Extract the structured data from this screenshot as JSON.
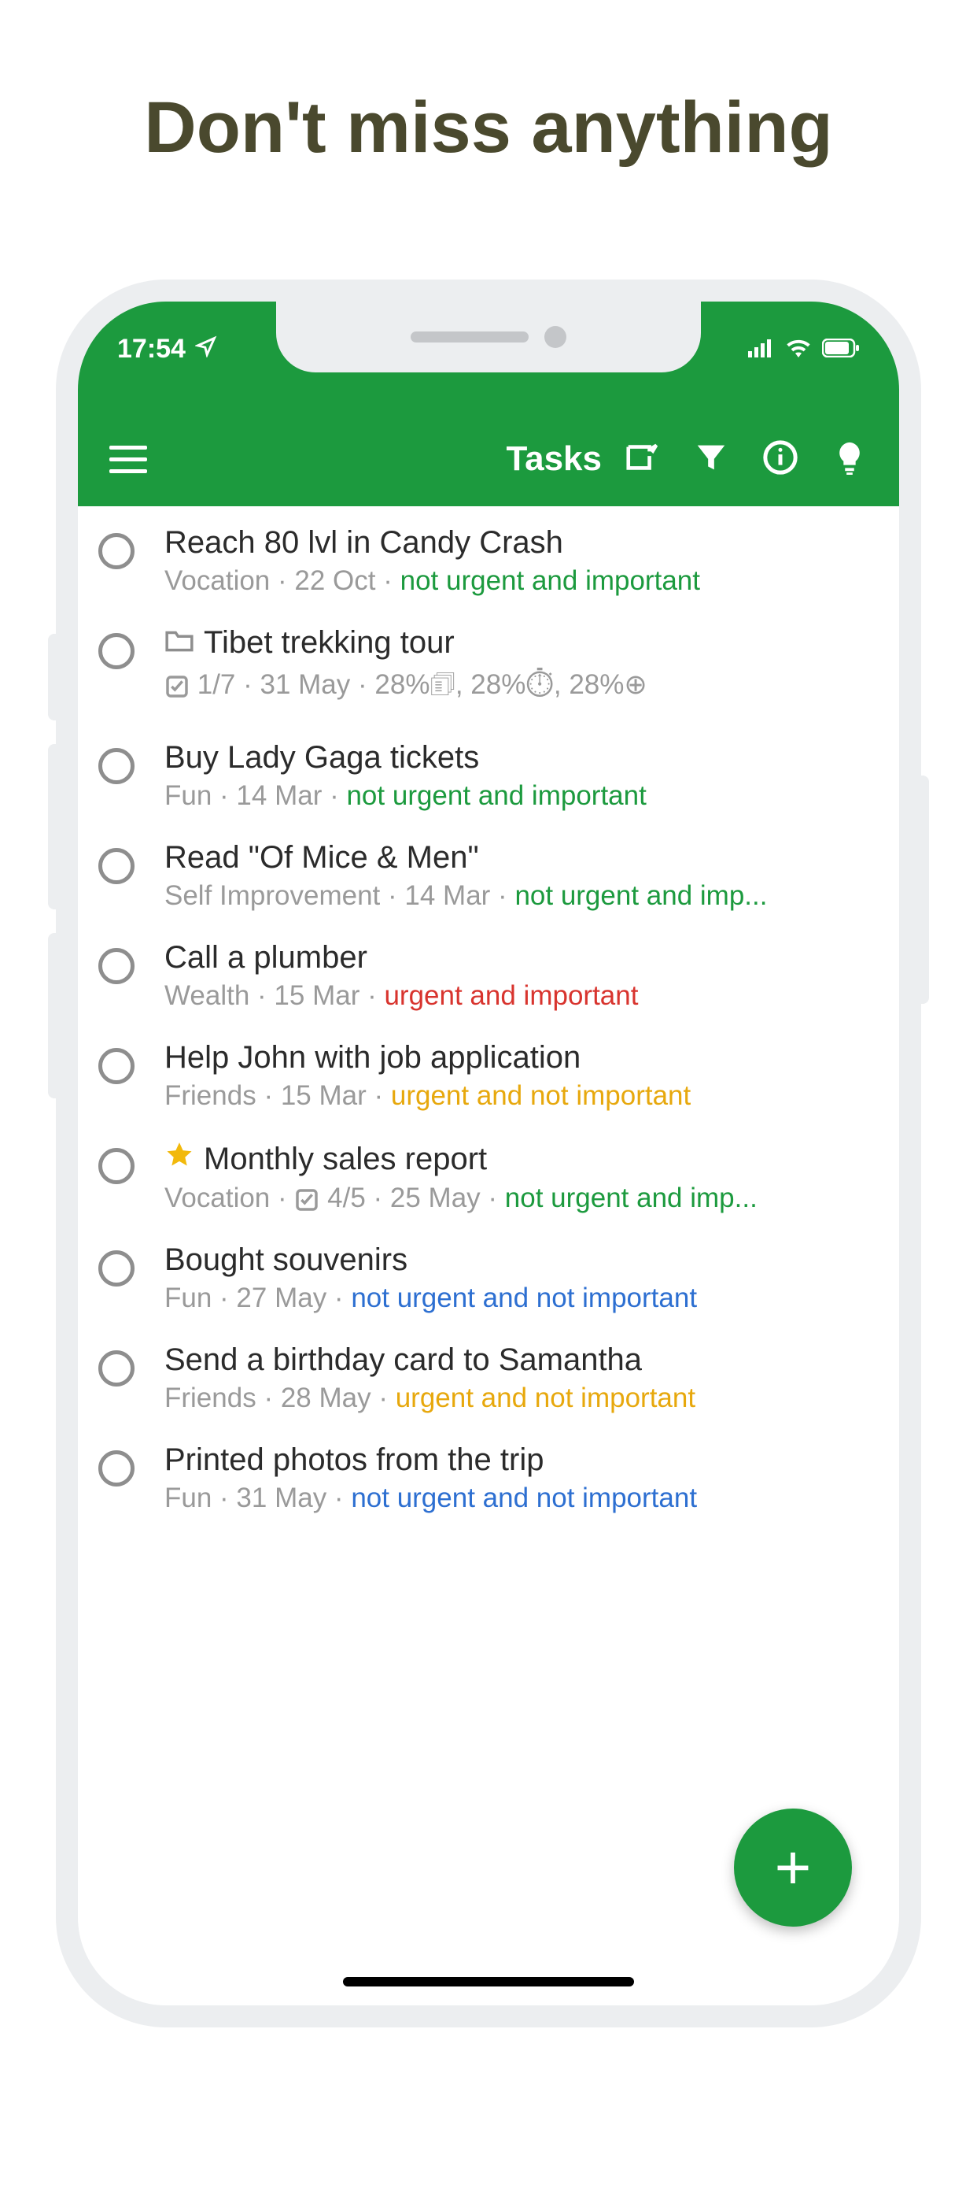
{
  "page": {
    "headline": "Don't miss anything"
  },
  "status": {
    "time": "17:54"
  },
  "toolbar": {
    "title": "Tasks"
  },
  "priorities": {
    "green": "not urgent and important",
    "red": "urgent and important",
    "yellow": "urgent and not important",
    "blue": "not urgent and not important",
    "green_trunc": "not urgent and imp..."
  },
  "tasks": [
    {
      "title": "Reach 80 lvl in Candy Crash",
      "category": "Vocation",
      "date": "22 Oct",
      "priority_key": "green"
    },
    {
      "title": "Tibet trekking tour",
      "has_folder": true,
      "checklist": "1/7",
      "date": "31 May",
      "progress_text": "28%🗊, 28%⏱, 28%⊕"
    },
    {
      "title": "Buy Lady Gaga tickets",
      "category": "Fun",
      "date": "14 Mar",
      "priority_key": "green"
    },
    {
      "title": "Read \"Of Mice & Men\"",
      "category": "Self Improvement",
      "date": "14 Mar",
      "priority_key": "green_trunc"
    },
    {
      "title": "Call a plumber",
      "category": "Wealth",
      "date": "15 Mar",
      "priority_key": "red"
    },
    {
      "title": "Help John with job application",
      "category": "Friends",
      "date": "15 Mar",
      "priority_key": "yellow"
    },
    {
      "title": "Monthly sales report",
      "has_star": true,
      "category": "Vocation",
      "checklist": "4/5",
      "date": "25 May",
      "priority_key": "green_trunc"
    },
    {
      "title": "Bought souvenirs",
      "category": "Fun",
      "date": "27 May",
      "priority_key": "blue"
    },
    {
      "title": "Send a birthday card to Samantha",
      "category": "Friends",
      "date": "28 May",
      "priority_key": "yellow"
    },
    {
      "title": "Printed photos from the trip",
      "category": "Fun",
      "date": "31 May",
      "priority_key": "blue"
    }
  ],
  "colors": {
    "accent": "#1c9a3e"
  }
}
